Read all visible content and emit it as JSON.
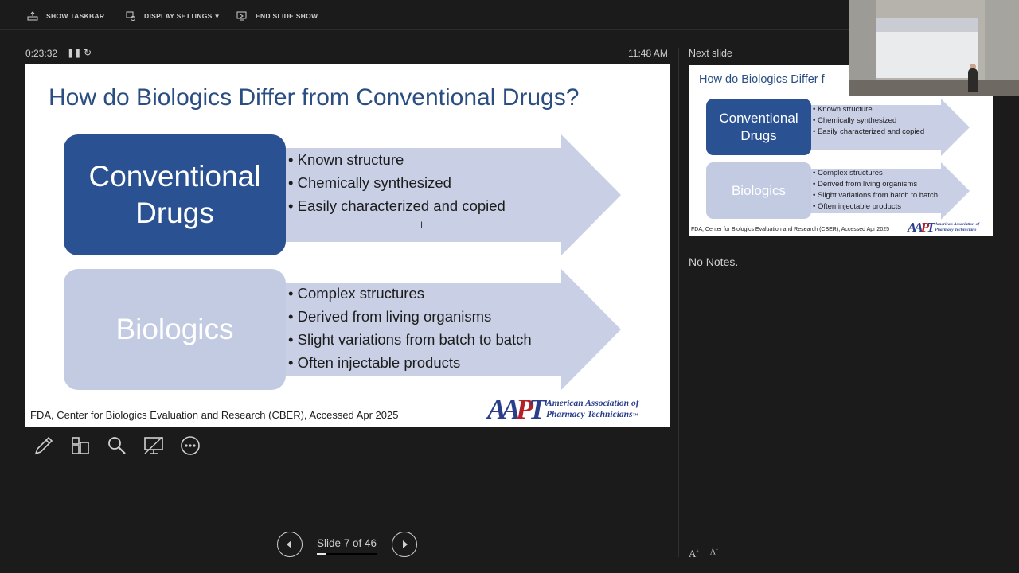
{
  "toolbar": {
    "show_taskbar": "SHOW TASKBAR",
    "display_settings": "DISPLAY SETTINGS",
    "end_slide_show": "END SLIDE SHOW"
  },
  "timer": {
    "elapsed": "0:23:32",
    "clock": "11:48 AM"
  },
  "current_slide": {
    "title": "How do Biologics Differ from Conventional Drugs?",
    "conventional_label_line1": "Conventional",
    "conventional_label_line2": "Drugs",
    "conventional_bullets": [
      "Known structure",
      "Chemically synthesized",
      "Easily characterized and copied"
    ],
    "biologics_label": "Biologics",
    "biologics_bullets": [
      "Complex structures",
      "Derived from living organisms",
      "Slight variations from batch to batch",
      "Often injectable products"
    ],
    "source": "FDA, Center for Biologics Evaluation and Research (CBER), Accessed Apr 2025",
    "logo_mark": "AAPT",
    "logo_text_line1": "American Association of",
    "logo_text_line2": "Pharmacy Technicians",
    "logo_tm": "™"
  },
  "next_slide": {
    "label": "Next slide",
    "title": "How do Biologics Differ f",
    "conventional_label_line1": "Conventional",
    "conventional_label_line2": "Drugs",
    "conventional_bullets": [
      "Known structure",
      "Chemically synthesized",
      "Easily characterized and copied"
    ],
    "biologics_label": "Biologics",
    "biologics_bullets": [
      "Complex structures",
      "Derived from living organisms",
      "Slight variations from batch to batch",
      "Often injectable products"
    ],
    "source": "FDA, Center for Biologics Evaluation and Research (CBER), Accessed Apr 2025",
    "logo_text_line1": "American Association of",
    "logo_text_line2": "Pharmacy Technicians"
  },
  "notes": "No Notes.",
  "navigation": {
    "slide_counter": "Slide 7 of 46",
    "current": 7,
    "total": 46,
    "progress_fraction": 0.152
  },
  "tools": [
    "pen-icon",
    "see-all-slides-icon",
    "zoom-icon",
    "black-screen-icon",
    "more-options-icon"
  ],
  "colors": {
    "background": "#1b1b1b",
    "slide_title": "#2a4d82",
    "conventional_box": "#2a5192",
    "biologics_box": "#c3cbe3",
    "arrow": "#c9d0e6",
    "logo_blue": "#2a3e8c",
    "logo_red": "#b42025"
  }
}
